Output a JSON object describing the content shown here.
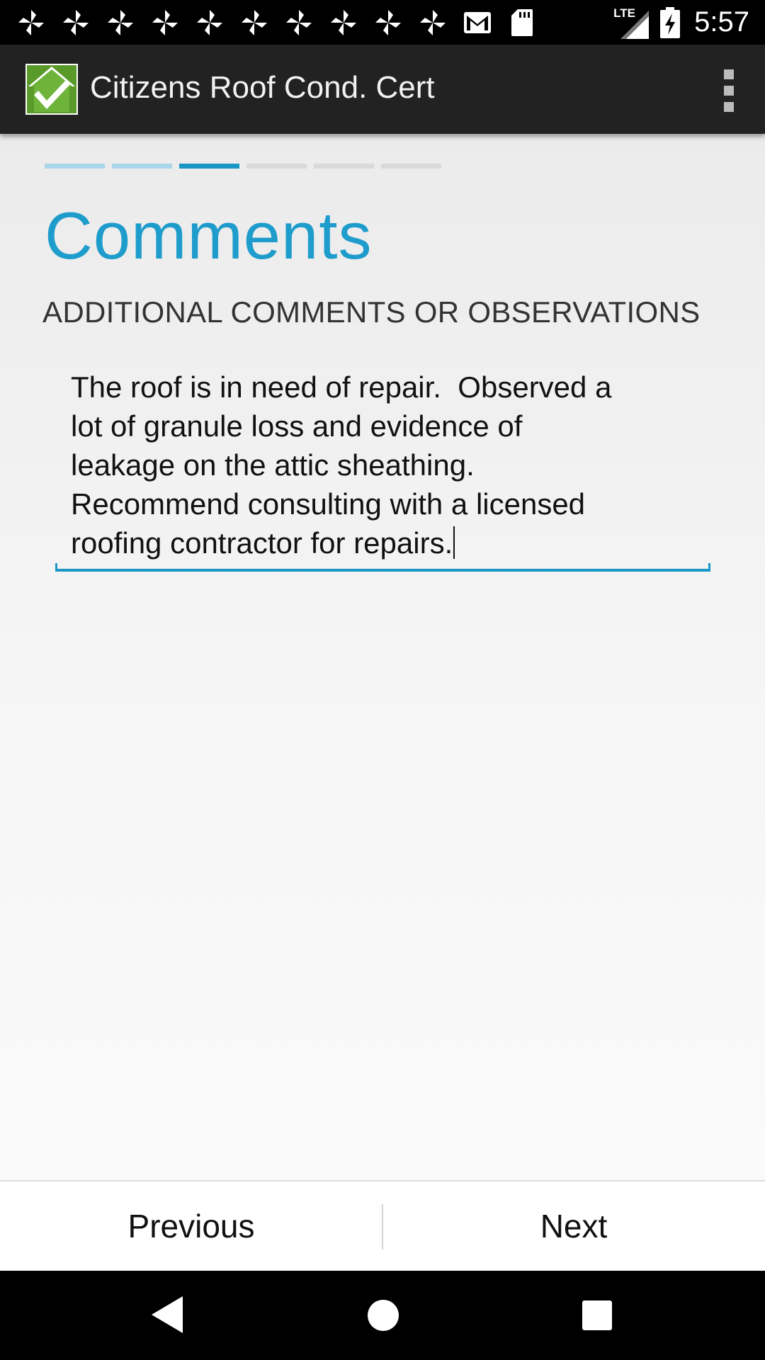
{
  "status_bar": {
    "time": "5:57",
    "network_label": "LTE",
    "notification_icons": [
      "pinwheel-icon",
      "pinwheel-icon",
      "pinwheel-icon",
      "pinwheel-icon",
      "pinwheel-icon",
      "pinwheel-icon",
      "pinwheel-icon",
      "pinwheel-icon",
      "pinwheel-icon",
      "pinwheel-icon",
      "gmail-icon",
      "sd-card-icon"
    ]
  },
  "action_bar": {
    "title": "Citizens Roof Cond. Cert",
    "logo_icon": "house-checkmark-icon",
    "overflow_icon": "overflow-menu-icon"
  },
  "progress": {
    "total_steps": 6,
    "current_step": 3
  },
  "page": {
    "title": "Comments",
    "section_label": "ADDITIONAL COMMENTS OR OBSERVATIONS",
    "comments_value": "The roof is in need of repair.  Observed a\nlot of granule loss and evidence of\nleakage on the attic sheathing.\nRecommend consulting with a licensed\nroofing contractor for repairs."
  },
  "buttons": {
    "previous_label": "Previous",
    "next_label": "Next"
  },
  "colors": {
    "accent": "#1a97c6",
    "title": "#1e9ccb",
    "action_bar": "#222222"
  }
}
